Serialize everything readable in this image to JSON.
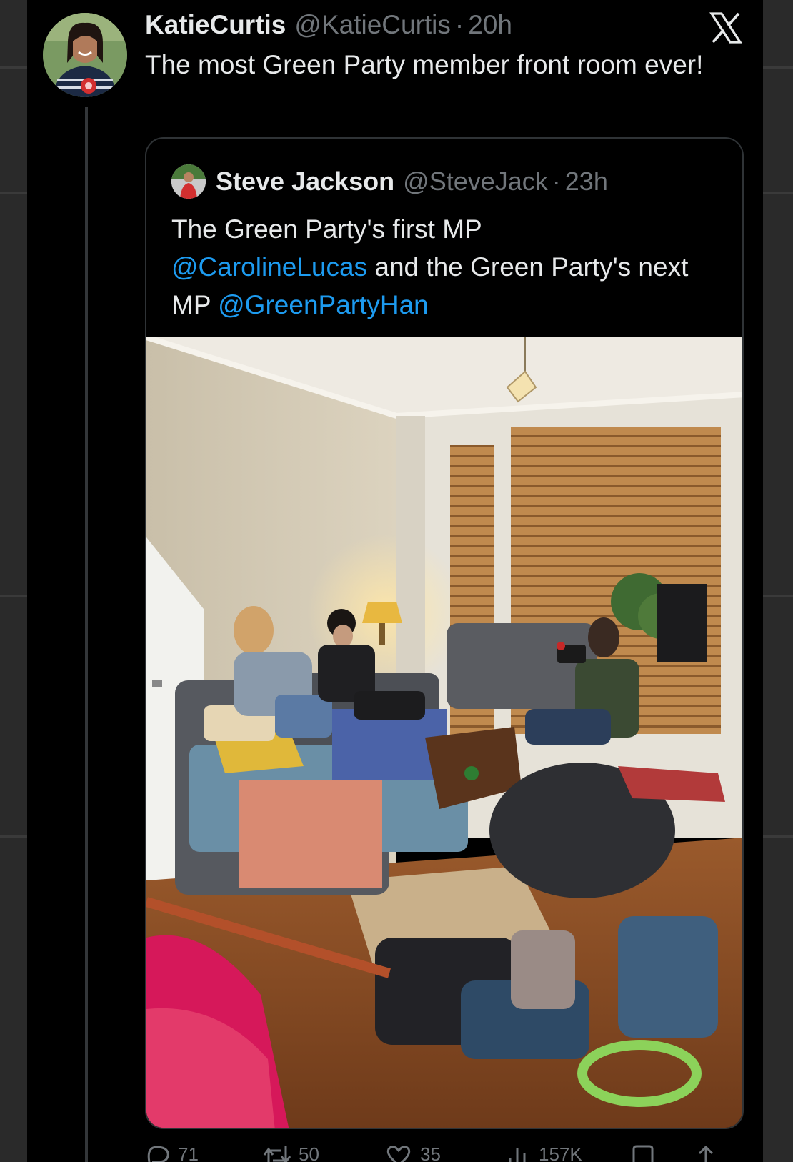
{
  "tweet": {
    "author": {
      "display_name": "KatieCurtis",
      "handle": "@KatieCurtis",
      "separator": "·",
      "time": "20h"
    },
    "text": "The most Green Party member front room ever!",
    "actions": [
      {
        "icon": "reply-icon",
        "count": "71"
      },
      {
        "icon": "retweet-icon",
        "count": "50"
      },
      {
        "icon": "like-icon",
        "count": "35"
      },
      {
        "icon": "views-icon",
        "count": "157K"
      },
      {
        "icon": "bookmark-icon",
        "count": ""
      },
      {
        "icon": "share-icon",
        "count": ""
      }
    ]
  },
  "quoted_tweet": {
    "author": {
      "display_name": "Steve Jackson",
      "handle": "@SteveJack",
      "separator": "·",
      "time": "23h"
    },
    "text_part1": "The Green Party's first MP",
    "mention1": "@CarolineLucas",
    "text_part2": " and the Green Party's next MP ",
    "mention2": "@GreenPartyHan"
  },
  "brand": {
    "logo": "x-logo-icon",
    "accent": "#1d9bf0",
    "text_primary": "#e7e9ea",
    "text_secondary": "#71767b",
    "background": "#000000"
  }
}
